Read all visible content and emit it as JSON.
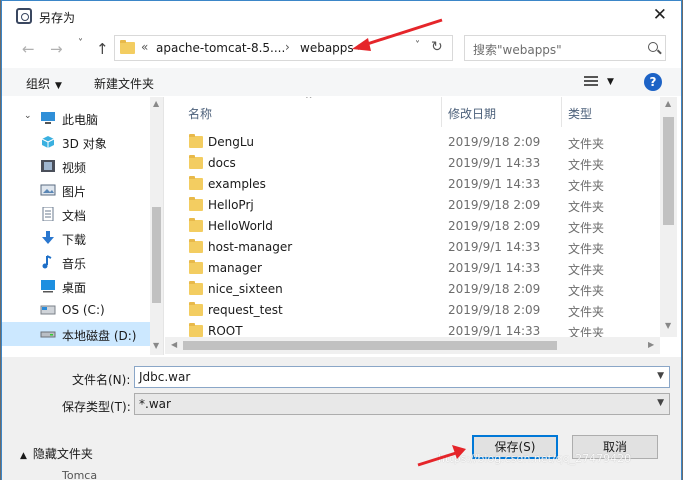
{
  "window": {
    "title": "另存为",
    "close_glyph": "✕"
  },
  "nav": {
    "back_glyph": "←",
    "forward_glyph": "→",
    "dropdown_glyph": "˅",
    "up_glyph": "↑",
    "crumbs_prefix": "«",
    "crumbs": [
      "apache-tomcat-8.5....",
      "webapps"
    ],
    "crumb_sep": "›",
    "refresh_glyph": "↻",
    "search_placeholder": "搜索\"webapps\""
  },
  "toolbar": {
    "organize": "组织",
    "new_folder": "新建文件夹",
    "help": "?"
  },
  "sidebar": {
    "items": [
      {
        "label": "此电脑",
        "icon": "pc-icon"
      },
      {
        "label": "3D 对象",
        "icon": "cube-icon"
      },
      {
        "label": "视频",
        "icon": "video-icon"
      },
      {
        "label": "图片",
        "icon": "picture-icon"
      },
      {
        "label": "文档",
        "icon": "document-icon"
      },
      {
        "label": "下载",
        "icon": "download-icon"
      },
      {
        "label": "音乐",
        "icon": "music-icon"
      },
      {
        "label": "桌面",
        "icon": "desktop-icon"
      },
      {
        "label": "OS (C:)",
        "icon": "drive-icon"
      },
      {
        "label": "本地磁盘 (D:)",
        "icon": "drive-icon"
      }
    ]
  },
  "columns": {
    "name": "名称",
    "date": "修改日期",
    "type": "类型"
  },
  "files": [
    {
      "name": "DengLu",
      "date": "2019/9/18 2:09",
      "type": "文件夹"
    },
    {
      "name": "docs",
      "date": "2019/9/1 14:33",
      "type": "文件夹"
    },
    {
      "name": "examples",
      "date": "2019/9/1 14:33",
      "type": "文件夹"
    },
    {
      "name": "HelloPrj",
      "date": "2019/9/18 2:09",
      "type": "文件夹"
    },
    {
      "name": "HelloWorld",
      "date": "2019/9/18 2:09",
      "type": "文件夹"
    },
    {
      "name": "host-manager",
      "date": "2019/9/1 14:33",
      "type": "文件夹"
    },
    {
      "name": "manager",
      "date": "2019/9/1 14:33",
      "type": "文件夹"
    },
    {
      "name": "nice_sixteen",
      "date": "2019/9/18 2:09",
      "type": "文件夹"
    },
    {
      "name": "request_test",
      "date": "2019/9/18 2:09",
      "type": "文件夹"
    },
    {
      "name": "ROOT",
      "date": "2019/9/1 14:33",
      "type": "文件夹"
    }
  ],
  "form": {
    "filename_label": "文件名(N):",
    "filename_value": "Jdbc.war",
    "type_label": "保存类型(T):",
    "type_value": "*.war",
    "hide_folders": "隐藏文件夹",
    "save": "保存(S)",
    "cancel": "取消",
    "behind_text": "Tomca"
  },
  "watermark": "https://blog.csdn.net/qq_27479420",
  "colors": {
    "accent": "#0078d7",
    "annotation_arrow": "#e5252a",
    "folder": "#f3cd61"
  }
}
